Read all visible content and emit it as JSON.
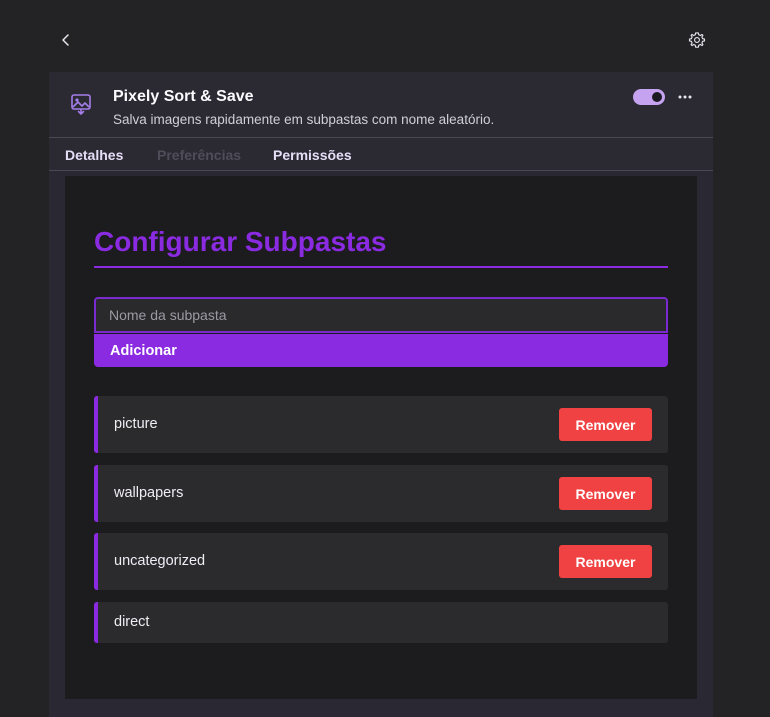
{
  "nav": {
    "back_icon": "chevron-left-icon",
    "settings_icon": "gear-icon"
  },
  "extension": {
    "icon": "image-save-icon",
    "name": "Pixely Sort & Save",
    "description": "Salva imagens rapidamente em subpastas com nome aleatório.",
    "enabled": true,
    "more_icon": "more-horizontal-icon"
  },
  "tabs": [
    {
      "label": "Detalhes",
      "state": "active"
    },
    {
      "label": "Preferências",
      "state": "disabled"
    },
    {
      "label": "Permissões",
      "state": "active"
    }
  ],
  "options": {
    "heading": "Configurar Subpastas",
    "input": {
      "placeholder": "Nome da subpasta",
      "value": ""
    },
    "add_label": "Adicionar",
    "folders": [
      {
        "name": "picture",
        "remove_label": "Remover"
      },
      {
        "name": "wallpapers",
        "remove_label": "Remover"
      },
      {
        "name": "uncategorized",
        "remove_label": "Remover"
      },
      {
        "name": "direct",
        "remove_label": ""
      }
    ]
  },
  "colors": {
    "accent": "#8a2be2",
    "remove": "#f04242",
    "toggle": "#c5a3f0"
  }
}
